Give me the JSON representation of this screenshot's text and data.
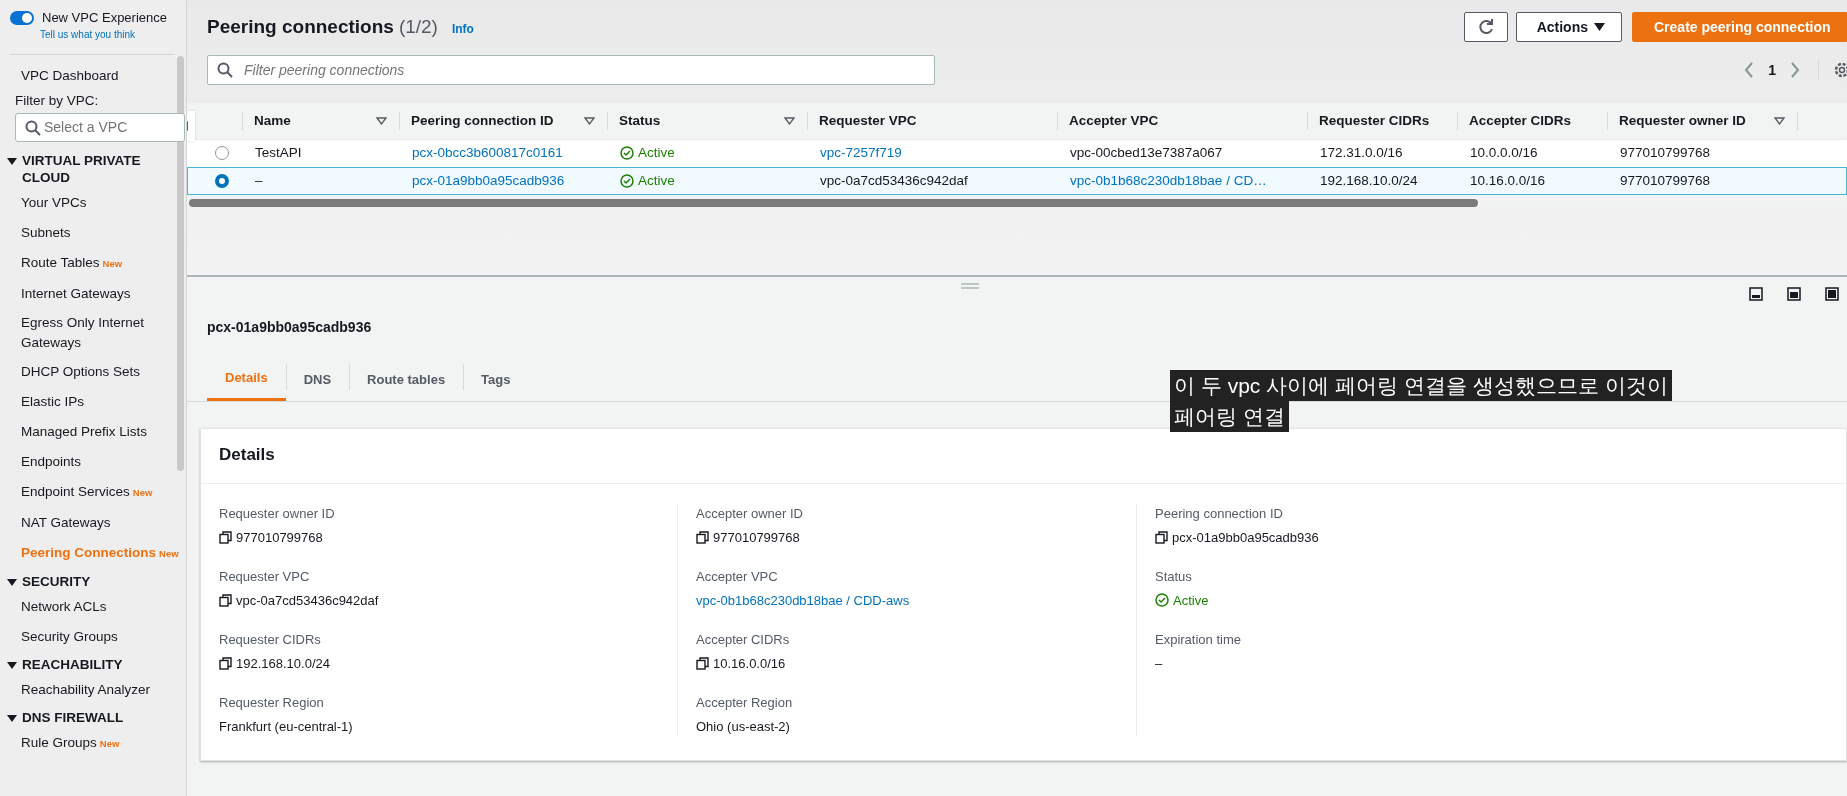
{
  "sidebar": {
    "toggle": {
      "label": "New VPC Experience",
      "on": true
    },
    "feedback_link": "Tell us what you think",
    "dashboard": "VPC Dashboard",
    "filter_label": "Filter by VPC:",
    "filter_placeholder": "Select a VPC",
    "sections": [
      {
        "title": "VIRTUAL PRIVATE CLOUD",
        "expanded": true,
        "items": [
          {
            "label": "Your VPCs",
            "selected": false
          },
          {
            "label": "Subnets",
            "selected": false
          },
          {
            "label": "Route Tables",
            "badge": "New",
            "selected": false
          },
          {
            "label": "Internet Gateways",
            "selected": false
          },
          {
            "label": "Egress Only Internet Gateways",
            "selected": false
          },
          {
            "label": "DHCP Options Sets",
            "selected": false
          },
          {
            "label": "Elastic IPs",
            "selected": false
          },
          {
            "label": "Managed Prefix Lists",
            "selected": false
          },
          {
            "label": "Endpoints",
            "selected": false
          },
          {
            "label": "Endpoint Services",
            "badge": "New",
            "selected": false
          },
          {
            "label": "NAT Gateways",
            "selected": false
          },
          {
            "label": "Peering Connections",
            "badge": "New",
            "selected": true
          }
        ]
      },
      {
        "title": "SECURITY",
        "expanded": true,
        "items": [
          {
            "label": "Network ACLs",
            "selected": false
          },
          {
            "label": "Security Groups",
            "selected": false
          }
        ]
      },
      {
        "title": "REACHABILITY",
        "expanded": true,
        "items": [
          {
            "label": "Reachability Analyzer",
            "selected": false
          }
        ]
      },
      {
        "title": "DNS FIREWALL",
        "expanded": true,
        "items": [
          {
            "label": "Rule Groups",
            "badge": "New",
            "selected": false
          }
        ]
      }
    ]
  },
  "header": {
    "title": "Peering connections",
    "count": "(1/2)",
    "info": "Info",
    "actions": "Actions",
    "create": "Create peering connection",
    "filter_placeholder": "Filter peering connections",
    "page": "1"
  },
  "table": {
    "columns": [
      {
        "label": "Name",
        "sortable": true
      },
      {
        "label": "Peering connection ID",
        "sortable": true
      },
      {
        "label": "Status",
        "sortable": true
      },
      {
        "label": "Requester VPC",
        "sortable": false
      },
      {
        "label": "Accepter VPC",
        "sortable": false
      },
      {
        "label": "Requester CIDRs",
        "sortable": false
      },
      {
        "label": "Accepter CIDRs",
        "sortable": false
      },
      {
        "label": "Requester owner ID",
        "sortable": true
      }
    ],
    "rows": [
      {
        "selected": false,
        "cells": [
          {
            "kind": "text",
            "text": "TestAPI"
          },
          {
            "kind": "link",
            "text": "pcx-0bcc3b600817c0161"
          },
          {
            "kind": "status",
            "text": "Active"
          },
          {
            "kind": "link",
            "text": "vpc-7257f719"
          },
          {
            "kind": "text",
            "text": "vpc-00cbed13e7387a067"
          },
          {
            "kind": "text",
            "text": "172.31.0.0/16"
          },
          {
            "kind": "text",
            "text": "10.0.0.0/16"
          },
          {
            "kind": "text",
            "text": "977010799768"
          }
        ]
      },
      {
        "selected": true,
        "cells": [
          {
            "kind": "text",
            "text": "–"
          },
          {
            "kind": "link",
            "text": "pcx-01a9bb0a95cadb936"
          },
          {
            "kind": "status",
            "text": "Active"
          },
          {
            "kind": "text",
            "text": "vpc-0a7cd53436c942daf"
          },
          {
            "kind": "link",
            "text": "vpc-0b1b68c230db18bae / CD…"
          },
          {
            "kind": "text",
            "text": "192.168.10.0/24"
          },
          {
            "kind": "text",
            "text": "10.16.0.0/16"
          },
          {
            "kind": "text",
            "text": "977010799768"
          }
        ]
      }
    ]
  },
  "detail": {
    "title": "pcx-01a9bb0a95cadb936",
    "tabs": [
      {
        "label": "Details",
        "selected": true
      },
      {
        "label": "DNS",
        "selected": false
      },
      {
        "label": "Route tables",
        "selected": false
      },
      {
        "label": "Tags",
        "selected": false
      }
    ],
    "card_title": "Details",
    "columns": [
      [
        {
          "label": "Requester owner ID",
          "kind": "copy",
          "value": "977010799768"
        },
        {
          "label": "Requester VPC",
          "kind": "copy",
          "value": "vpc-0a7cd53436c942daf"
        },
        {
          "label": "Requester CIDRs",
          "kind": "copy",
          "value": "192.168.10.0/24"
        },
        {
          "label": "Requester Region",
          "kind": "plain",
          "value": "Frankfurt (eu-central-1)"
        }
      ],
      [
        {
          "label": "Accepter owner ID",
          "kind": "copy",
          "value": "977010799768"
        },
        {
          "label": "Accepter VPC",
          "kind": "link",
          "value": "vpc-0b1b68c230db18bae / CDD-aws"
        },
        {
          "label": "Accepter CIDRs",
          "kind": "copy",
          "value": "10.16.0.0/16"
        },
        {
          "label": "Accepter Region",
          "kind": "plain",
          "value": "Ohio (us-east-2)"
        }
      ],
      [
        {
          "label": "Peering connection ID",
          "kind": "copy",
          "value": "pcx-01a9bb0a95cadb936"
        },
        {
          "label": "Status",
          "kind": "status",
          "value": "Active"
        },
        {
          "label": "Expiration time",
          "kind": "plain",
          "value": "–"
        }
      ]
    ]
  },
  "caption": [
    "이 두 vpc 사이에 페어링 연결을 생성했으므로 이것이",
    "페어링 연결"
  ]
}
